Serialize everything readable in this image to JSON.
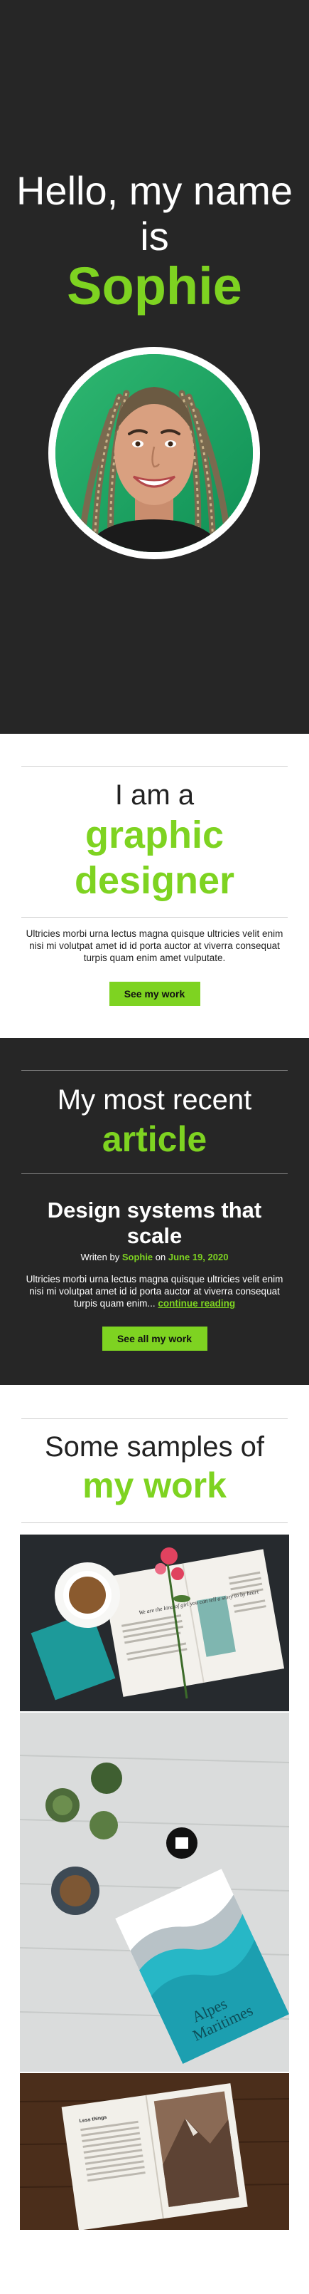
{
  "hero": {
    "greeting_line1": "Hello, my name",
    "greeting_line2": "is",
    "name": "Sophie"
  },
  "intro": {
    "heading": "I am a",
    "role_line1": "graphic",
    "role_line2": "designer",
    "body": "Ultricies morbi urna lectus magna quisque ultricies velit enim nisi mi volutpat amet id id porta auctor at viverra consequat turpis quam enim amet vulputate.",
    "button_label": "See my work"
  },
  "recent": {
    "heading": "My most recent",
    "highlight": "article",
    "article_title": "Design systems that scale",
    "byline_prefix": "Writen by",
    "author": "Sophie",
    "byline_mid": "on",
    "date": "June 19, 2020",
    "excerpt": "Ultricies morbi urna lectus magna quisque ultricies velit enim nisi mi volutpat amet id id porta auctor at viverra consequat turpis quam enim...",
    "continue_label": "continue reading",
    "button_label": "See all my work"
  },
  "samples": {
    "heading": "Some samples of",
    "highlight": "my work",
    "magazine_headline": "We are the kind of girl you can tell a story to by heart",
    "cover_title_line1": "Alpes",
    "cover_title_line2": "Maritimes",
    "book_page_header": "Less things"
  },
  "colors": {
    "accent": "#7ed321",
    "dark_bg": "#262626",
    "light_bg": "#ffffff"
  }
}
